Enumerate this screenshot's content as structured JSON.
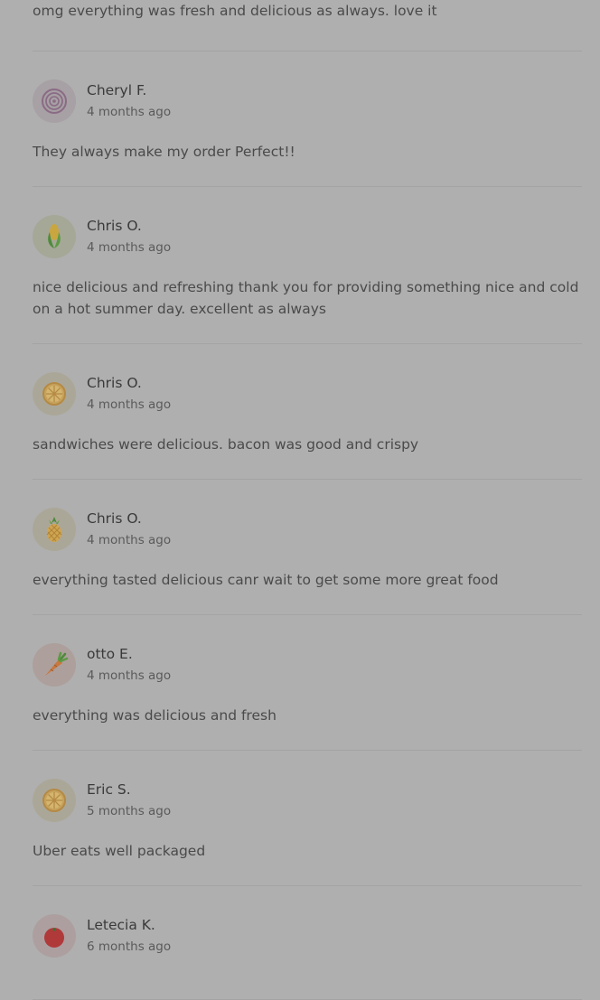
{
  "top_review_text": "omg everything was fresh and delicious as always. love it",
  "reviews": [
    {
      "name": "Cheryl F.",
      "date": "4 months ago",
      "text": "They always make my order Perfect!!",
      "avatar_icon": "onion-icon",
      "avatar_bg": "#a7a0a4"
    },
    {
      "name": "Chris O.",
      "date": "4 months ago",
      "text": "nice delicious and refreshing thank you for providing something nice and cold on a hot summer day. excellent as always",
      "avatar_icon": "corn-icon",
      "avatar_bg": "#a5a897"
    },
    {
      "name": "Chris O.",
      "date": "4 months ago",
      "text": "sandwiches were delicious. bacon was good and crispy",
      "avatar_icon": "lemon-slice-icon",
      "avatar_bg": "#aba798"
    },
    {
      "name": "Chris O.",
      "date": "4 months ago",
      "text": "everything tasted delicious canr wait to get some more great food",
      "avatar_icon": "pineapple-icon",
      "avatar_bg": "#aba798"
    },
    {
      "name": "otto E.",
      "date": "4 months ago",
      "text": "everything was delicious and fresh",
      "avatar_icon": "carrot-icon",
      "avatar_bg": "#ad9f9b"
    },
    {
      "name": "Eric S.",
      "date": "5 months ago",
      "text": "Uber eats well packaged",
      "avatar_icon": "lemon-slice-icon",
      "avatar_bg": "#aba798"
    },
    {
      "name": "Letecia K.",
      "date": "6 months ago",
      "text": "",
      "avatar_icon": "tomato-icon",
      "avatar_bg": "#ad9f9f"
    }
  ]
}
